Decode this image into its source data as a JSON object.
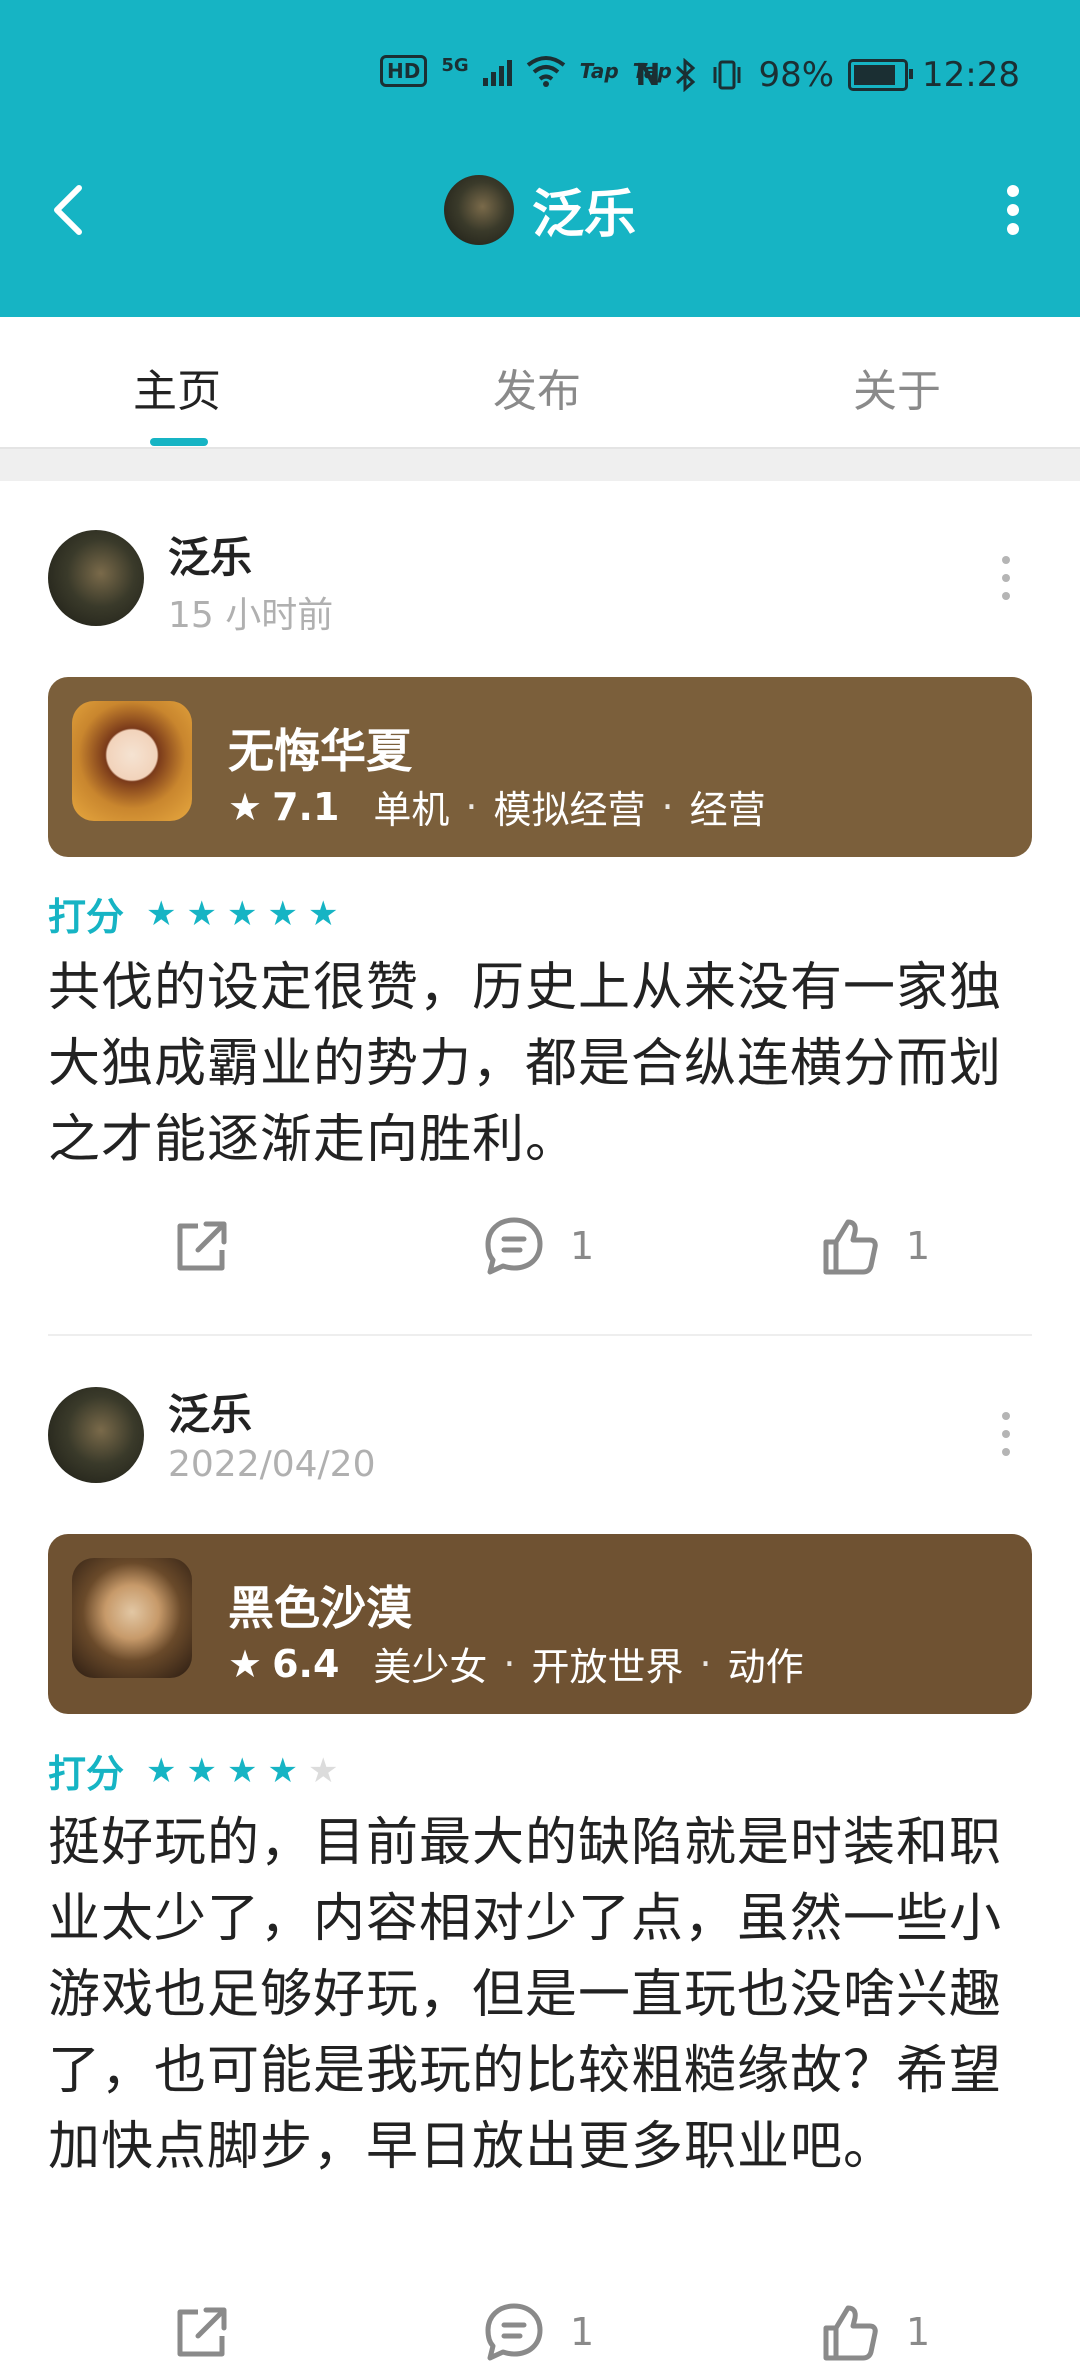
{
  "status_bar": {
    "hd": "HD",
    "network": "5G",
    "taptap_1": "Tap",
    "taptap_2": "Tap",
    "battery": "98%",
    "time": "12:28",
    "battery_level": 0.98
  },
  "header": {
    "title": "泛乐",
    "back_icon": "chevron-left-icon",
    "more_icon": "more-vertical-icon"
  },
  "tabs": [
    {
      "label": "主页",
      "active": true
    },
    {
      "label": "发布",
      "active": false
    },
    {
      "label": "关于",
      "active": false
    }
  ],
  "posts": [
    {
      "author": "泛乐",
      "time": "15 小时前",
      "game": {
        "title": "无悔华夏",
        "score": "7.1",
        "tags": [
          "单机",
          "模拟经营",
          "经营"
        ]
      },
      "rating_label": "打分",
      "rating": 5,
      "text": "共伐的设定很赞，历史上从来没有一家独大独成霸业的势力，都是合纵连横分而划之才能逐渐走向胜利。",
      "comments": "1",
      "likes": "1"
    },
    {
      "author": "泛乐",
      "time": "2022/04/20",
      "game": {
        "title": "黑色沙漠",
        "score": "6.4",
        "tags": [
          "美少女",
          "开放世界",
          "动作"
        ]
      },
      "rating_label": "打分",
      "rating": 4,
      "text": "挺好玩的，目前最大的缺陷就是时装和职业太少了，内容相对少了点，虽然一些小游戏也足够好玩，但是一直玩也没啥兴趣了，也可能是我玩的比较粗糙缘故？希望加快点脚步，早日放出更多职业吧。",
      "comments": "1",
      "likes": "1"
    }
  ],
  "colors": {
    "accent": "#16b4c4",
    "card_brown": "#7b5f3b"
  }
}
